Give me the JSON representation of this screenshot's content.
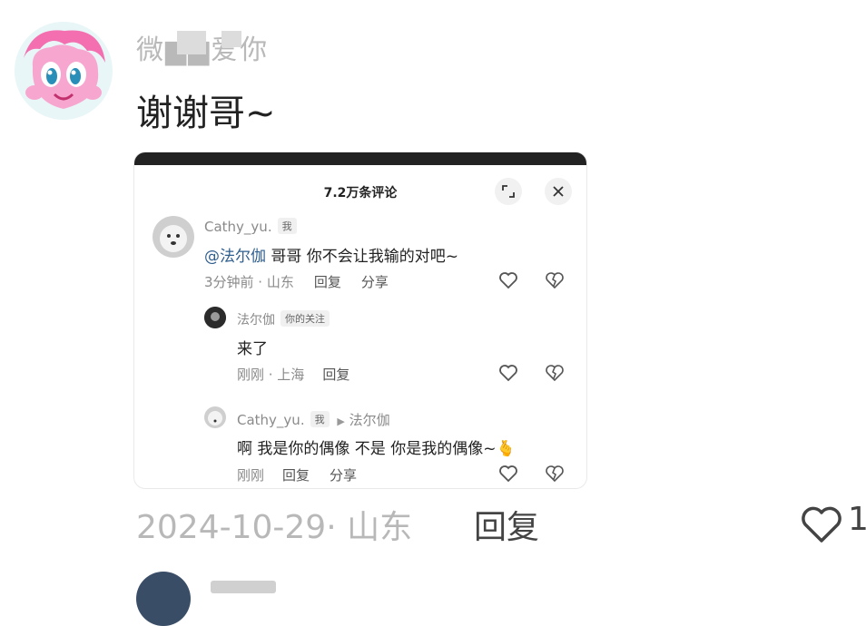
{
  "top_comment": {
    "username": "微▆▆爱你",
    "text": "谢谢哥~",
    "date_location": "2024-10-29· 山东",
    "reply_label": "回复",
    "likes": "1"
  },
  "embedded": {
    "title": "7.2万条评论",
    "expand_icon": "expand-icon",
    "close_icon": "close-icon",
    "comments": [
      {
        "user": "Cathy_yu.",
        "tag": "我",
        "mention": "@法尔伽",
        "text": " 哥哥 你不会让我输的对吧~",
        "time_loc": "3分钟前 · 山东",
        "reply": "回复",
        "share": "分享"
      },
      {
        "user": "法尔伽",
        "tag": "你的关注",
        "text": "来了",
        "time_loc": "刚刚 · 上海",
        "reply": "回复"
      },
      {
        "user": "Cathy_yu.",
        "tag": "我",
        "reply_to_arrow": "▶",
        "reply_to": "法尔伽",
        "text": "啊 我是你的偶像 不是 你是我的偶像~🫰",
        "time_loc": "刚刚",
        "reply": "回复",
        "share": "分享"
      }
    ]
  },
  "colors": {
    "accent_mention": "#2f5f8f",
    "muted_text": "#8a8a8a",
    "embed_topbar": "#222222"
  }
}
